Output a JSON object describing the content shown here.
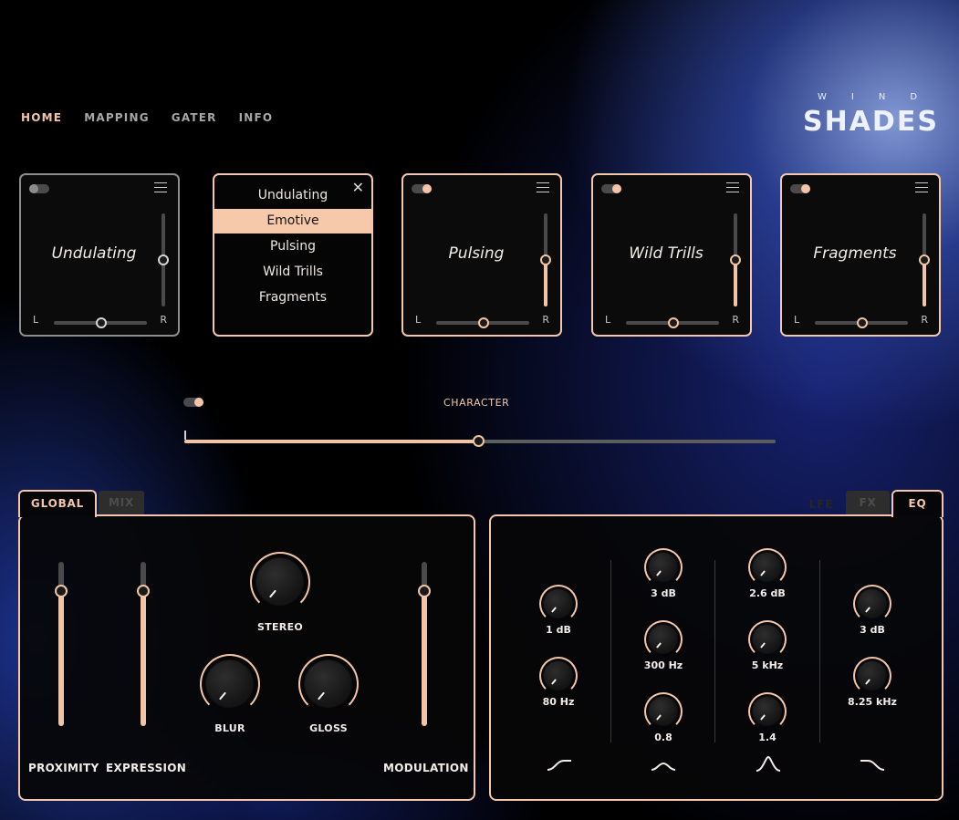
{
  "nav": {
    "items": [
      "HOME",
      "MAPPING",
      "GATER",
      "INFO"
    ],
    "active": "HOME"
  },
  "logo": {
    "top": "WIND",
    "main": "SHADES"
  },
  "layers": [
    {
      "name": "Undulating",
      "enabled": false,
      "level": 0.5,
      "pan": 0.5
    },
    {
      "name": "Pulsing",
      "enabled": true,
      "level": 0.5,
      "pan": 0.5
    },
    {
      "name": "Wild Trills",
      "enabled": true,
      "level": 0.5,
      "pan": 0.6
    },
    {
      "name": "Fragments",
      "enabled": true,
      "level": 0.5,
      "pan": 0.5
    }
  ],
  "pan_labels": {
    "left": "L",
    "right": "R"
  },
  "dropdown": {
    "close_glyph": "✕",
    "options": [
      "Undulating",
      "Emotive",
      "Pulsing",
      "Wild Trills",
      "Fragments"
    ],
    "selected": "Emotive"
  },
  "character": {
    "label": "CHARACTER",
    "enabled": true,
    "value": 0.5
  },
  "global_panel": {
    "tabs": [
      "GLOBAL",
      "MIX"
    ],
    "active_tab": "GLOBAL",
    "sliders": [
      {
        "label": "PROXIMITY",
        "value": 0.85
      },
      {
        "label": "EXPRESSION",
        "value": 0.85
      },
      {
        "label": "MODULATION",
        "value": 0.85
      }
    ],
    "knobs": [
      {
        "label": "STEREO"
      },
      {
        "label": "BLUR"
      },
      {
        "label": "GLOSS"
      }
    ]
  },
  "eq_panel": {
    "tabs": [
      "LFE",
      "FX",
      "EQ"
    ],
    "active_tab": "EQ",
    "bands": [
      {
        "gain": "1 dB",
        "freq": "80 Hz",
        "shape": "low-shelf"
      },
      {
        "gain": "3 dB",
        "freq": "300 Hz",
        "q": "0.8",
        "shape": "bell"
      },
      {
        "gain": "2.6 dB",
        "freq": "5 kHz",
        "q": "1.4",
        "shape": "peak"
      },
      {
        "gain": "3 dB",
        "freq": "8.25 kHz",
        "shape": "high-shelf"
      }
    ]
  },
  "colors": {
    "accent": "#f3c6a8",
    "track": "#4a4a4a",
    "background": "#000000",
    "glow": "#3a55c8"
  }
}
